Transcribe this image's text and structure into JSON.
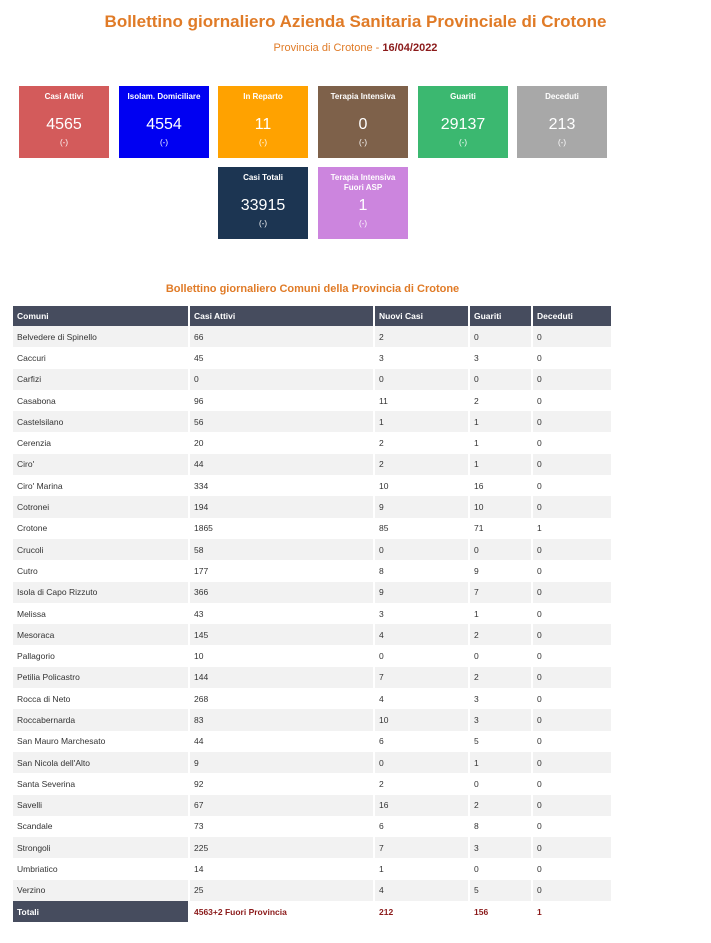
{
  "header": {
    "title": "Bollettino giornaliero Azienda Sanitaria Provinciale di Crotone",
    "subtitle_prefix": "Provincia di Crotone - ",
    "date": "16/04/2022"
  },
  "tiles": [
    {
      "label": "Casi Attivi",
      "value": "4565",
      "change": "(-)",
      "color": "#d35b5b"
    },
    {
      "label": "Isolam. Domiciliare",
      "value": "4554",
      "change": "(-)",
      "color": "#0000f2"
    },
    {
      "label": "In Reparto",
      "value": "11",
      "change": "(-)",
      "color": "#ffa200"
    },
    {
      "label": "Terapia Intensiva",
      "value": "0",
      "change": "(-)",
      "color": "#7e614a"
    },
    {
      "label": "Guariti",
      "value": "29137",
      "change": "(-)",
      "color": "#3bb870"
    },
    {
      "label": "Deceduti",
      "value": "213",
      "change": "(-)",
      "color": "#a8a8a8"
    },
    {
      "label": "Casi Totali",
      "value": "33915",
      "change": "(-)",
      "color": "#1c3552"
    },
    {
      "label": "Terapia Intensiva Fuori ASP",
      "value": "1",
      "change": "(-)",
      "color": "#cc85de"
    }
  ],
  "table": {
    "title": "Bollettino giornaliero Comuni della Provincia di Crotone",
    "headers": [
      "Comuni",
      "Casi Attivi",
      "Nuovi Casi",
      "Guariti",
      "Deceduti"
    ],
    "rows": [
      [
        "Belvedere di Spinello",
        "66",
        "2",
        "0",
        "0"
      ],
      [
        "Caccuri",
        "45",
        "3",
        "3",
        "0"
      ],
      [
        "Carfizi",
        "0",
        "0",
        "0",
        "0"
      ],
      [
        "Casabona",
        "96",
        "11",
        "2",
        "0"
      ],
      [
        "Castelsilano",
        "56",
        "1",
        "1",
        "0"
      ],
      [
        "Cerenzia",
        "20",
        "2",
        "1",
        "0"
      ],
      [
        "Ciro'",
        "44",
        "2",
        "1",
        "0"
      ],
      [
        "Ciro' Marina",
        "334",
        "10",
        "16",
        "0"
      ],
      [
        "Cotronei",
        "194",
        "9",
        "10",
        "0"
      ],
      [
        "Crotone",
        "1865",
        "85",
        "71",
        "1"
      ],
      [
        "Crucoli",
        "58",
        "0",
        "0",
        "0"
      ],
      [
        "Cutro",
        "177",
        "8",
        "9",
        "0"
      ],
      [
        "Isola di Capo Rizzuto",
        "366",
        "9",
        "7",
        "0"
      ],
      [
        "Melissa",
        "43",
        "3",
        "1",
        "0"
      ],
      [
        "Mesoraca",
        "145",
        "4",
        "2",
        "0"
      ],
      [
        "Pallagorio",
        "10",
        "0",
        "0",
        "0"
      ],
      [
        "Petilia Policastro",
        "144",
        "7",
        "2",
        "0"
      ],
      [
        "Rocca di Neto",
        "268",
        "4",
        "3",
        "0"
      ],
      [
        "Roccabernarda",
        "83",
        "10",
        "3",
        "0"
      ],
      [
        "San Mauro Marchesato",
        "44",
        "6",
        "5",
        "0"
      ],
      [
        "San Nicola dell'Alto",
        "9",
        "0",
        "1",
        "0"
      ],
      [
        "Santa Severina",
        "92",
        "2",
        "0",
        "0"
      ],
      [
        "Savelli",
        "67",
        "16",
        "2",
        "0"
      ],
      [
        "Scandale",
        "73",
        "6",
        "8",
        "0"
      ],
      [
        "Strongoli",
        "225",
        "7",
        "3",
        "0"
      ],
      [
        "Umbriatico",
        "14",
        "1",
        "0",
        "0"
      ],
      [
        "Verzino",
        "25",
        "4",
        "5",
        "0"
      ]
    ],
    "totals": [
      "Totali",
      "4563+2 Fuori Provincia",
      "212",
      "156",
      "1"
    ]
  }
}
